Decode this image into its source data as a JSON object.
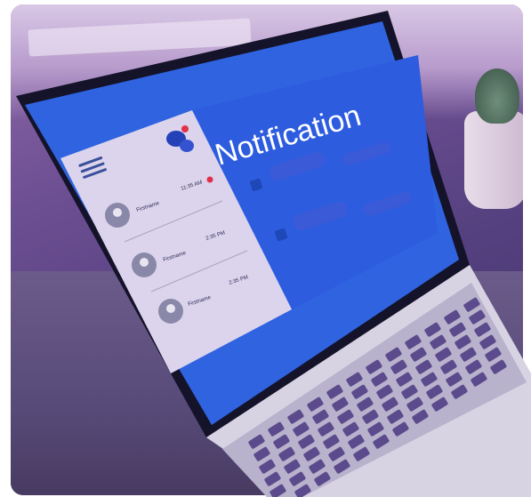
{
  "screen": {
    "heading": "Notification",
    "notifications": [
      {
        "name": "Firstname",
        "time": "11:35 AM",
        "unread": true
      },
      {
        "name": "Firstname",
        "time": "2:35 PM",
        "unread": false
      },
      {
        "name": "Firstname",
        "time": "2:35 PM",
        "unread": false
      }
    ]
  },
  "icons": {
    "menu": "hamburger-menu-icon",
    "chat": "chat-bubbles-icon",
    "avatar": "user-avatar-icon"
  },
  "colors": {
    "screen_blue": "#2f63e0",
    "panel_light": "#dcd4ec",
    "badge_red": "#e0314a",
    "pill_blue": "#3a5ad8"
  }
}
